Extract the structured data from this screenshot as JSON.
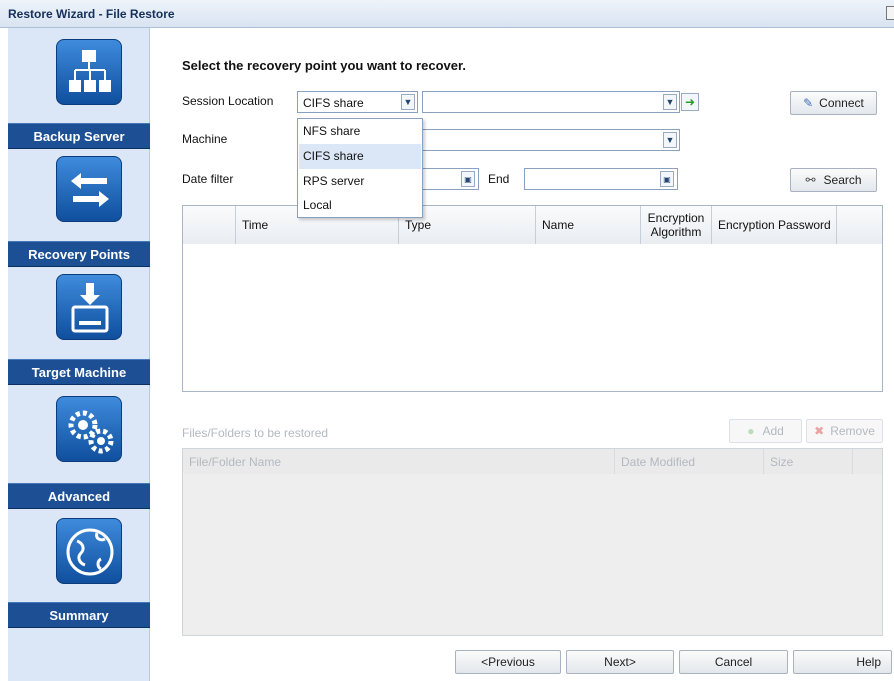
{
  "window": {
    "title": "Restore Wizard - File Restore"
  },
  "sidebar": {
    "steps": [
      {
        "label": "Backup Server",
        "icon": "network-server-icon"
      },
      {
        "label": "Recovery Points",
        "icon": "arrows-exchange-icon"
      },
      {
        "label": "Target Machine",
        "icon": "drive-download-icon"
      },
      {
        "label": "Advanced",
        "icon": "gears-icon"
      },
      {
        "label": "Summary",
        "icon": "globe-icon"
      }
    ]
  },
  "form": {
    "heading": "Select the recovery point you want to recover.",
    "session_location_label": "Session Location",
    "session_location_value": "CIFS share",
    "session_location_options": [
      "NFS share",
      "CIFS share",
      "RPS server",
      "Local"
    ],
    "machine_label": "Machine",
    "date_filter_label": "Date filter",
    "end_label": "End",
    "connect_button": "Connect",
    "search_button": "Search"
  },
  "recovery_table": {
    "columns": [
      "Time",
      "Type",
      "Name",
      "Encryption Algorithm",
      "Encryption Password"
    ]
  },
  "files_section": {
    "title": "Files/Folders to be restored",
    "add_button": "Add",
    "remove_button": "Remove",
    "columns": [
      "File/Folder Name",
      "Date Modified",
      "Size"
    ]
  },
  "footer": {
    "previous": "<Previous",
    "next": "Next>",
    "cancel": "Cancel",
    "help": "Help"
  },
  "colors": {
    "sidebar_label_bg": "#1d4f95",
    "sidebar_bg": "#dbe6f6",
    "accent_green": "#2a9a2a"
  }
}
